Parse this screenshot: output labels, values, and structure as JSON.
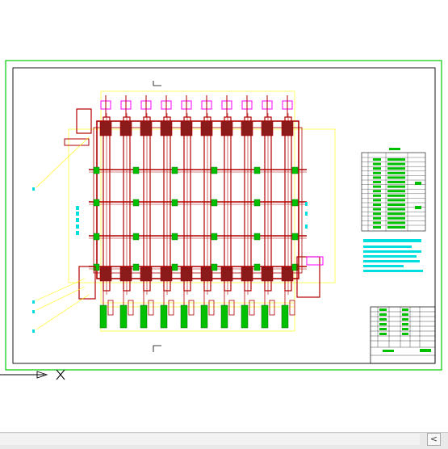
{
  "colors": {
    "background": "#ffffff",
    "frame_border": "#00cc00",
    "drawing_border": "#000000",
    "frame_red": "#b00000",
    "accent_magenta": "#ff00ff",
    "dimension_yellow": "#ffff00",
    "annotation_cyan": "#00dede",
    "component_green": "#00c000",
    "ucs_black": "#000000"
  },
  "drawing": {
    "roller_count": 10,
    "crossbeam_count": 4,
    "table_rows": 16
  },
  "ucs_icon": {
    "x_label": "X"
  },
  "statusbar": {
    "scroll_left_icon": "chevron-left-icon",
    "scroll_left_glyph": "<"
  }
}
